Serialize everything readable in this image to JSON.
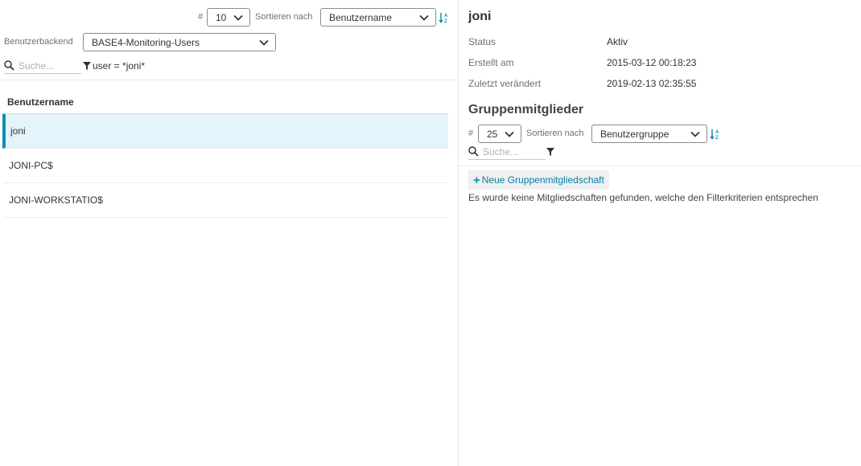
{
  "list_panel": {
    "limit_label": "#",
    "limit_value": "10",
    "sort_label": "Sortieren nach",
    "sort_value": "Benutzername",
    "backend_label": "Benutzerbackend",
    "backend_value": "BASE4-Monitoring-Users",
    "search_placeholder": "Suche...",
    "filter_text": "user = *joni*",
    "column_header": "Benutzername",
    "rows": [
      {
        "name": "joni",
        "selected": true
      },
      {
        "name": "JONI-PC$",
        "selected": false
      },
      {
        "name": "JONI-WORKSTATIO$",
        "selected": false
      }
    ]
  },
  "detail_panel": {
    "username": "joni",
    "fields": [
      {
        "label": "Status",
        "value": "Aktiv"
      },
      {
        "label": "Erstellt am",
        "value": "2015-03-12 00:18:23"
      },
      {
        "label": "Zuletzt verändert",
        "value": "2019-02-13 02:35:55"
      }
    ],
    "group_section_title": "Gruppenmitglieder",
    "group_limit_label": "#",
    "group_limit_value": "25",
    "group_sort_label": "Sortieren nach",
    "group_sort_value": "Benutzergruppe",
    "group_search_placeholder": "Suche...",
    "add_membership_label": "Neue Gruppenmitgliedschaft",
    "empty_message": "Es wurde keine Mitgliedschaften gefunden, welche den Filterkriterien entsprechen"
  },
  "colors": {
    "accent": "#0b8fb1",
    "selected_row_bg": "#e3f4fa"
  },
  "icons": [
    "chevron-down-icon",
    "sort-alpha-icon",
    "search-icon",
    "filter-icon",
    "plus-icon"
  ]
}
